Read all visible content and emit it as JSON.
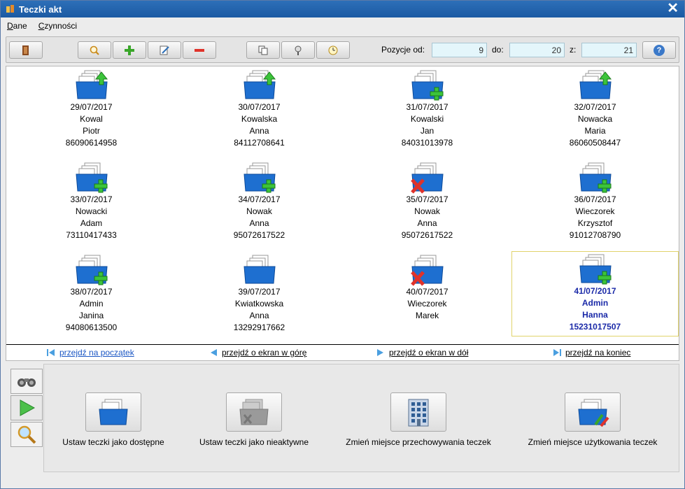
{
  "window": {
    "title": "Teczki akt",
    "close_glyph": "✕"
  },
  "menu": [
    "Dane",
    "Czynności"
  ],
  "toolbar": {
    "buttons": [
      "exit-icon",
      "search-icon",
      "add-icon",
      "edit-icon",
      "remove-icon",
      "copy-icon",
      "location-icon",
      "history-icon"
    ],
    "pos_from_label": "Pozycje od:",
    "pos_from": "9",
    "to_label": "do:",
    "to": "20",
    "of_label": "z:",
    "of": "21",
    "help": "?"
  },
  "folders": [
    {
      "date": "29/07/2017",
      "surname": "Kowal",
      "name": "Piotr",
      "id": "86090614958",
      "status": "up"
    },
    {
      "date": "30/07/2017",
      "surname": "Kowalska",
      "name": "Anna",
      "id": "84112708641",
      "status": "up"
    },
    {
      "date": "31/07/2017",
      "surname": "Kowalski",
      "name": "Jan",
      "id": "84031013978",
      "status": "plus"
    },
    {
      "date": "32/07/2017",
      "surname": "Nowacka",
      "name": "Maria",
      "id": "86060508447",
      "status": "up"
    },
    {
      "date": "33/07/2017",
      "surname": "Nowacki",
      "name": "Adam",
      "id": "73110417433",
      "status": "plus"
    },
    {
      "date": "34/07/2017",
      "surname": "Nowak",
      "name": "Anna",
      "id": "95072617522",
      "status": "plus"
    },
    {
      "date": "35/07/2017",
      "surname": "Nowak",
      "name": "Anna",
      "id": "95072617522",
      "status": "x"
    },
    {
      "date": "36/07/2017",
      "surname": "Wieczorek",
      "name": "Krzysztof",
      "id": "91012708790",
      "status": "plus"
    },
    {
      "date": "38/07/2017",
      "surname": "Admin",
      "name": "Janina",
      "id": "94080613500",
      "status": "plus"
    },
    {
      "date": "39/07/2017",
      "surname": "Kwiatkowska",
      "name": "Anna",
      "id": "13292917662",
      "status": "none"
    },
    {
      "date": "40/07/2017",
      "surname": "Wieczorek",
      "name": "Marek",
      "id": "",
      "status": "x"
    },
    {
      "date": "41/07/2017",
      "surname": "Admin",
      "name": "Hanna",
      "id": "15231017507",
      "status": "plus",
      "selected": true
    }
  ],
  "nav": {
    "first": "przejdź na początek",
    "prev": "przejdź o ekran w górę",
    "next": "przejdź o ekran w dół",
    "last": "przejdź na koniec"
  },
  "side_tabs": [
    "binoculars-icon",
    "play-icon",
    "magnifier-icon"
  ],
  "actions": [
    {
      "label": "Ustaw teczki jako dostępne",
      "icon": "folder-icon"
    },
    {
      "label": "Ustaw teczki jako nieaktywne",
      "icon": "folder-inactive-icon"
    },
    {
      "label": "Zmień miejsce przechowywania teczek",
      "icon": "building-icon"
    },
    {
      "label": "Zmień miejsce użytkowania teczek",
      "icon": "folder-move-icon"
    }
  ],
  "colors": {
    "accent": "#1b5aa3",
    "selected_text": "#1b2aa8",
    "input_bg": "#e4f6fb"
  }
}
